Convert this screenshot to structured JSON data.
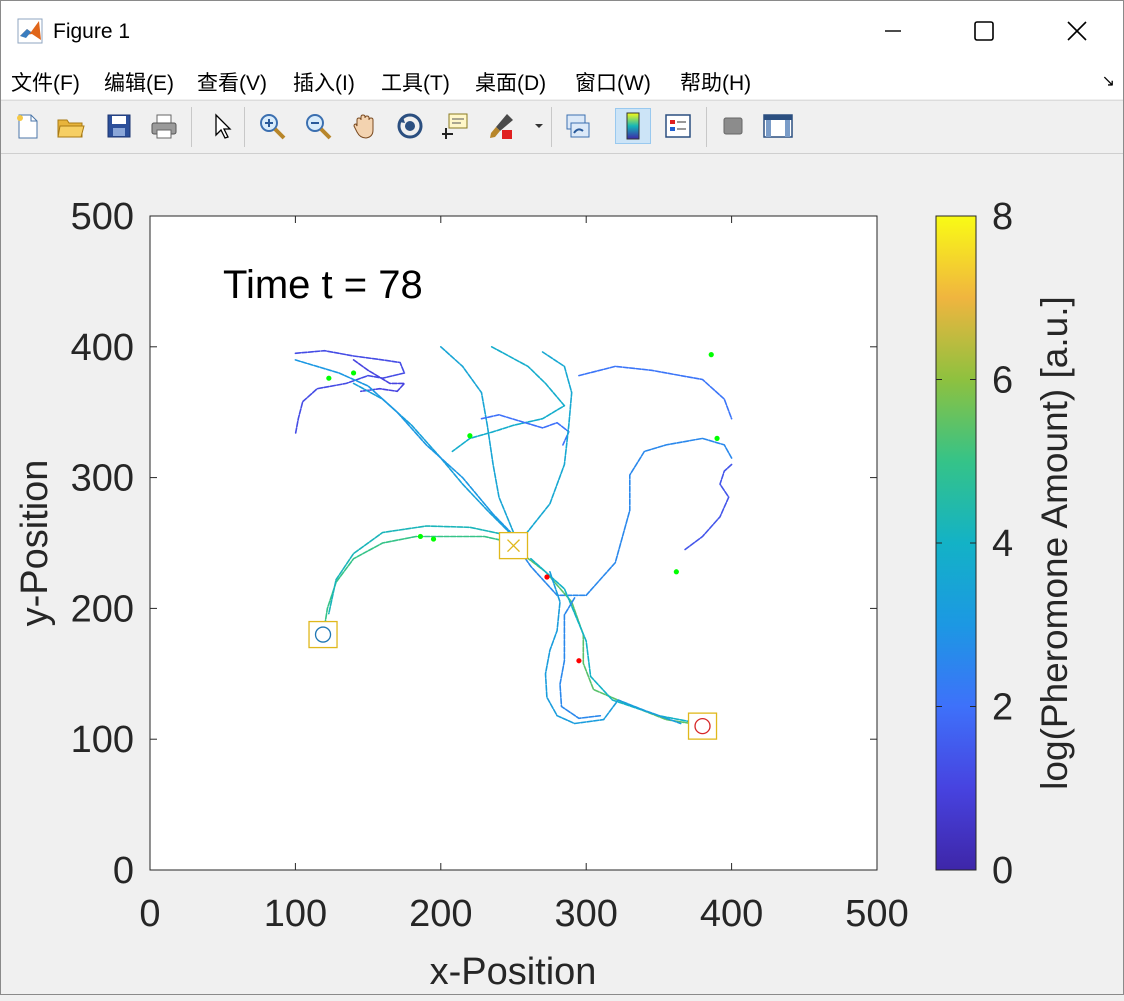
{
  "window": {
    "title": "Figure 1"
  },
  "menu": [
    "文件(F)",
    "编辑(E)",
    "查看(V)",
    "插入(I)",
    "工具(T)",
    "桌面(D)",
    "窗口(W)",
    "帮助(H)"
  ],
  "toolbar": {
    "icons": [
      "new-figure-icon",
      "open-file-icon",
      "save-icon",
      "print-icon",
      "edit-plot-icon",
      "zoom-in-icon",
      "zoom-out-icon",
      "pan-icon",
      "rotate-3d-icon",
      "data-cursor-icon",
      "brush-icon",
      "link-plot-icon",
      "colorbar-icon",
      "legend-icon",
      "hide-plot-tools-icon",
      "show-plot-tools-icon"
    ]
  },
  "plot": {
    "annotation": "Time t = 78",
    "xlabel": "x-Position",
    "ylabel": "y-Position",
    "xticks": [
      "0",
      "100",
      "200",
      "300",
      "400",
      "500"
    ],
    "yticks": [
      "0",
      "100",
      "200",
      "300",
      "400",
      "500"
    ],
    "colorbar_label": "log(Pheromone Amount) [a.u.]",
    "colorbar_ticks": [
      "0",
      "2",
      "4",
      "6",
      "8"
    ],
    "colors": {
      "nest": "#e0b81c",
      "food_1": "#1f77b4",
      "food_2": "#d62728",
      "ant_searching": "#00ff00",
      "ant_returning": "#ff0000"
    }
  },
  "chart_data": {
    "type": "scatter",
    "xlim": [
      0,
      500
    ],
    "ylim": [
      0,
      500
    ],
    "clim": [
      0,
      8
    ],
    "colormap": "parula",
    "nest": {
      "x": 250,
      "y": 248,
      "marker": "x"
    },
    "food_sources": [
      {
        "x": 119,
        "y": 180,
        "marker": "o",
        "color": "#1f77b4"
      },
      {
        "x": 380,
        "y": 110,
        "marker": "o",
        "color": "#d62728"
      }
    ],
    "ants_green": [
      {
        "x": 123,
        "y": 376
      },
      {
        "x": 140,
        "y": 380
      },
      {
        "x": 220,
        "y": 332
      },
      {
        "x": 186,
        "y": 255
      },
      {
        "x": 195,
        "y": 253
      },
      {
        "x": 386,
        "y": 394
      },
      {
        "x": 390,
        "y": 330
      },
      {
        "x": 362,
        "y": 228
      }
    ],
    "ants_red": [
      {
        "x": 273,
        "y": 224
      },
      {
        "x": 295,
        "y": 160
      }
    ],
    "trails": [
      {
        "level": 1.2,
        "points": [
          [
            100,
            395
          ],
          [
            120,
            397
          ],
          [
            140,
            393
          ],
          [
            160,
            390
          ],
          [
            172,
            388
          ],
          [
            175,
            380
          ],
          [
            160,
            376
          ],
          [
            150,
            378
          ],
          [
            135,
            372
          ],
          [
            115,
            368
          ],
          [
            105,
            358
          ],
          [
            102,
            345
          ],
          [
            100,
            333
          ]
        ]
      },
      {
        "level": 1.0,
        "points": [
          [
            140,
            390
          ],
          [
            150,
            382
          ],
          [
            165,
            372
          ],
          [
            175,
            372
          ],
          [
            170,
            366
          ],
          [
            158,
            368
          ],
          [
            145,
            366
          ]
        ]
      },
      {
        "level": 3.3,
        "points": [
          [
            140,
            372
          ],
          [
            160,
            360
          ],
          [
            180,
            340
          ],
          [
            200,
            315
          ],
          [
            215,
            295
          ],
          [
            232,
            275
          ],
          [
            250,
            255
          ]
        ]
      },
      {
        "level": 3.0,
        "points": [
          [
            100,
            390
          ],
          [
            130,
            380
          ],
          [
            150,
            370
          ],
          [
            170,
            350
          ],
          [
            190,
            325
          ],
          [
            215,
            300
          ],
          [
            236,
            272
          ],
          [
            250,
            256
          ]
        ]
      },
      {
        "level": 3.5,
        "points": [
          [
            200,
            400
          ],
          [
            215,
            385
          ],
          [
            228,
            365
          ],
          [
            232,
            340
          ],
          [
            236,
            310
          ],
          [
            240,
            285
          ],
          [
            250,
            258
          ]
        ]
      },
      {
        "level": 3.8,
        "points": [
          [
            235,
            400
          ],
          [
            260,
            385
          ],
          [
            272,
            372
          ],
          [
            285,
            355
          ],
          [
            270,
            345
          ],
          [
            250,
            340
          ],
          [
            236,
            335
          ],
          [
            220,
            330
          ],
          [
            208,
            320
          ]
        ]
      },
      {
        "level": 2.0,
        "points": [
          [
            228,
            345
          ],
          [
            240,
            348
          ],
          [
            255,
            343
          ],
          [
            270,
            338
          ],
          [
            280,
            342
          ],
          [
            288,
            335
          ],
          [
            284,
            325
          ]
        ]
      },
      {
        "level": 3.6,
        "points": [
          [
            270,
            396
          ],
          [
            285,
            385
          ],
          [
            290,
            365
          ],
          [
            288,
            340
          ],
          [
            285,
            310
          ],
          [
            275,
            280
          ],
          [
            255,
            252
          ]
        ]
      },
      {
        "level": 2.1,
        "points": [
          [
            295,
            378
          ],
          [
            320,
            385
          ],
          [
            345,
            382
          ],
          [
            365,
            378
          ],
          [
            380,
            375
          ],
          [
            395,
            360
          ],
          [
            400,
            345
          ]
        ]
      },
      {
        "level": 2.6,
        "points": [
          [
            400,
            315
          ],
          [
            395,
            325
          ],
          [
            380,
            330
          ],
          [
            355,
            325
          ],
          [
            340,
            320
          ],
          [
            330,
            302
          ],
          [
            330,
            275
          ],
          [
            320,
            235
          ],
          [
            300,
            210
          ],
          [
            280,
            210
          ],
          [
            262,
            232
          ],
          [
            252,
            248
          ]
        ]
      },
      {
        "level": 1.4,
        "points": [
          [
            400,
            310
          ],
          [
            395,
            305
          ],
          [
            392,
            295
          ],
          [
            398,
            285
          ],
          [
            392,
            270
          ],
          [
            380,
            255
          ],
          [
            368,
            245
          ]
        ]
      },
      {
        "level": 5.0,
        "points": [
          [
            250,
            250
          ],
          [
            230,
            255
          ],
          [
            205,
            255
          ],
          [
            183,
            255
          ],
          [
            160,
            250
          ],
          [
            140,
            238
          ],
          [
            128,
            220
          ],
          [
            122,
            200
          ],
          [
            120,
            186
          ]
        ]
      },
      {
        "level": 4.2,
        "points": [
          [
            250,
            255
          ],
          [
            220,
            262
          ],
          [
            190,
            263
          ],
          [
            160,
            258
          ],
          [
            140,
            242
          ],
          [
            128,
            222
          ],
          [
            123,
            196
          ]
        ]
      },
      {
        "level": 5.4,
        "points": [
          [
            252,
            245
          ],
          [
            272,
            228
          ],
          [
            290,
            205
          ],
          [
            298,
            180
          ],
          [
            298,
            158
          ],
          [
            305,
            138
          ],
          [
            330,
            126
          ],
          [
            355,
            115
          ],
          [
            378,
            111
          ]
        ]
      },
      {
        "level": 4.0,
        "points": [
          [
            262,
            238
          ],
          [
            285,
            215
          ],
          [
            300,
            175
          ],
          [
            303,
            148
          ],
          [
            318,
            130
          ],
          [
            350,
            118
          ],
          [
            378,
            112
          ]
        ]
      },
      {
        "level": 3.2,
        "points": [
          [
            275,
            228
          ],
          [
            282,
            205
          ],
          [
            280,
            183
          ],
          [
            275,
            168
          ],
          [
            272,
            150
          ],
          [
            273,
            132
          ],
          [
            280,
            118
          ],
          [
            292,
            112
          ],
          [
            312,
            115
          ],
          [
            322,
            130
          ],
          [
            340,
            122
          ],
          [
            365,
            112
          ]
        ]
      },
      {
        "level": 2.6,
        "points": [
          [
            292,
            208
          ],
          [
            285,
            195
          ],
          [
            285,
            175
          ],
          [
            285,
            160
          ],
          [
            282,
            142
          ],
          [
            283,
            125
          ],
          [
            295,
            116
          ],
          [
            310,
            118
          ]
        ]
      }
    ]
  }
}
